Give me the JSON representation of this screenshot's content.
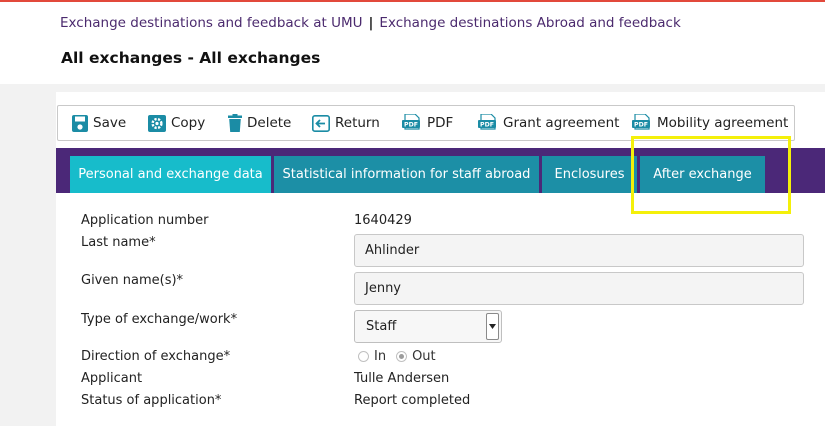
{
  "header": {
    "breadcrumb": [
      "Exchange destinations and feedback at UMU",
      "Exchange destinations Abroad and feedback"
    ],
    "separator": "|",
    "title": "All exchanges - All exchanges"
  },
  "toolbar": {
    "save": "Save",
    "copy": "Copy",
    "delete": "Delete",
    "return": "Return",
    "pdf": "PDF",
    "grant_agreement": "Grant agreement",
    "mobility_agreement": "Mobility agreement",
    "pdf_icon_text": "PDF"
  },
  "tabs": [
    {
      "label": "Personal and exchange data",
      "active": true
    },
    {
      "label": "Statistical information for staff abroad",
      "active": false
    },
    {
      "label": "Enclosures",
      "active": false
    },
    {
      "label": "After exchange",
      "active": false
    }
  ],
  "form": {
    "application_number": {
      "label": "Application number",
      "value": "1640429"
    },
    "last_name": {
      "label": "Last name*",
      "value": "Ahlinder"
    },
    "given_names": {
      "label": "Given name(s)*",
      "value": "Jenny"
    },
    "exchange_type": {
      "label": "Type of exchange/work*",
      "value": "Staff"
    },
    "direction": {
      "label": "Direction of exchange*",
      "options": [
        "In",
        "Out"
      ],
      "selected": "Out"
    },
    "applicant": {
      "label": "Applicant",
      "value": "Tulle Andersen"
    },
    "status": {
      "label": "Status of application*",
      "value": "Report completed"
    }
  },
  "colors": {
    "accent_top": "#e2493b",
    "purple": "#4b2878",
    "tab": "#1c8fa6",
    "tab_active": "#17bccb",
    "highlight": "#f4f00a"
  }
}
